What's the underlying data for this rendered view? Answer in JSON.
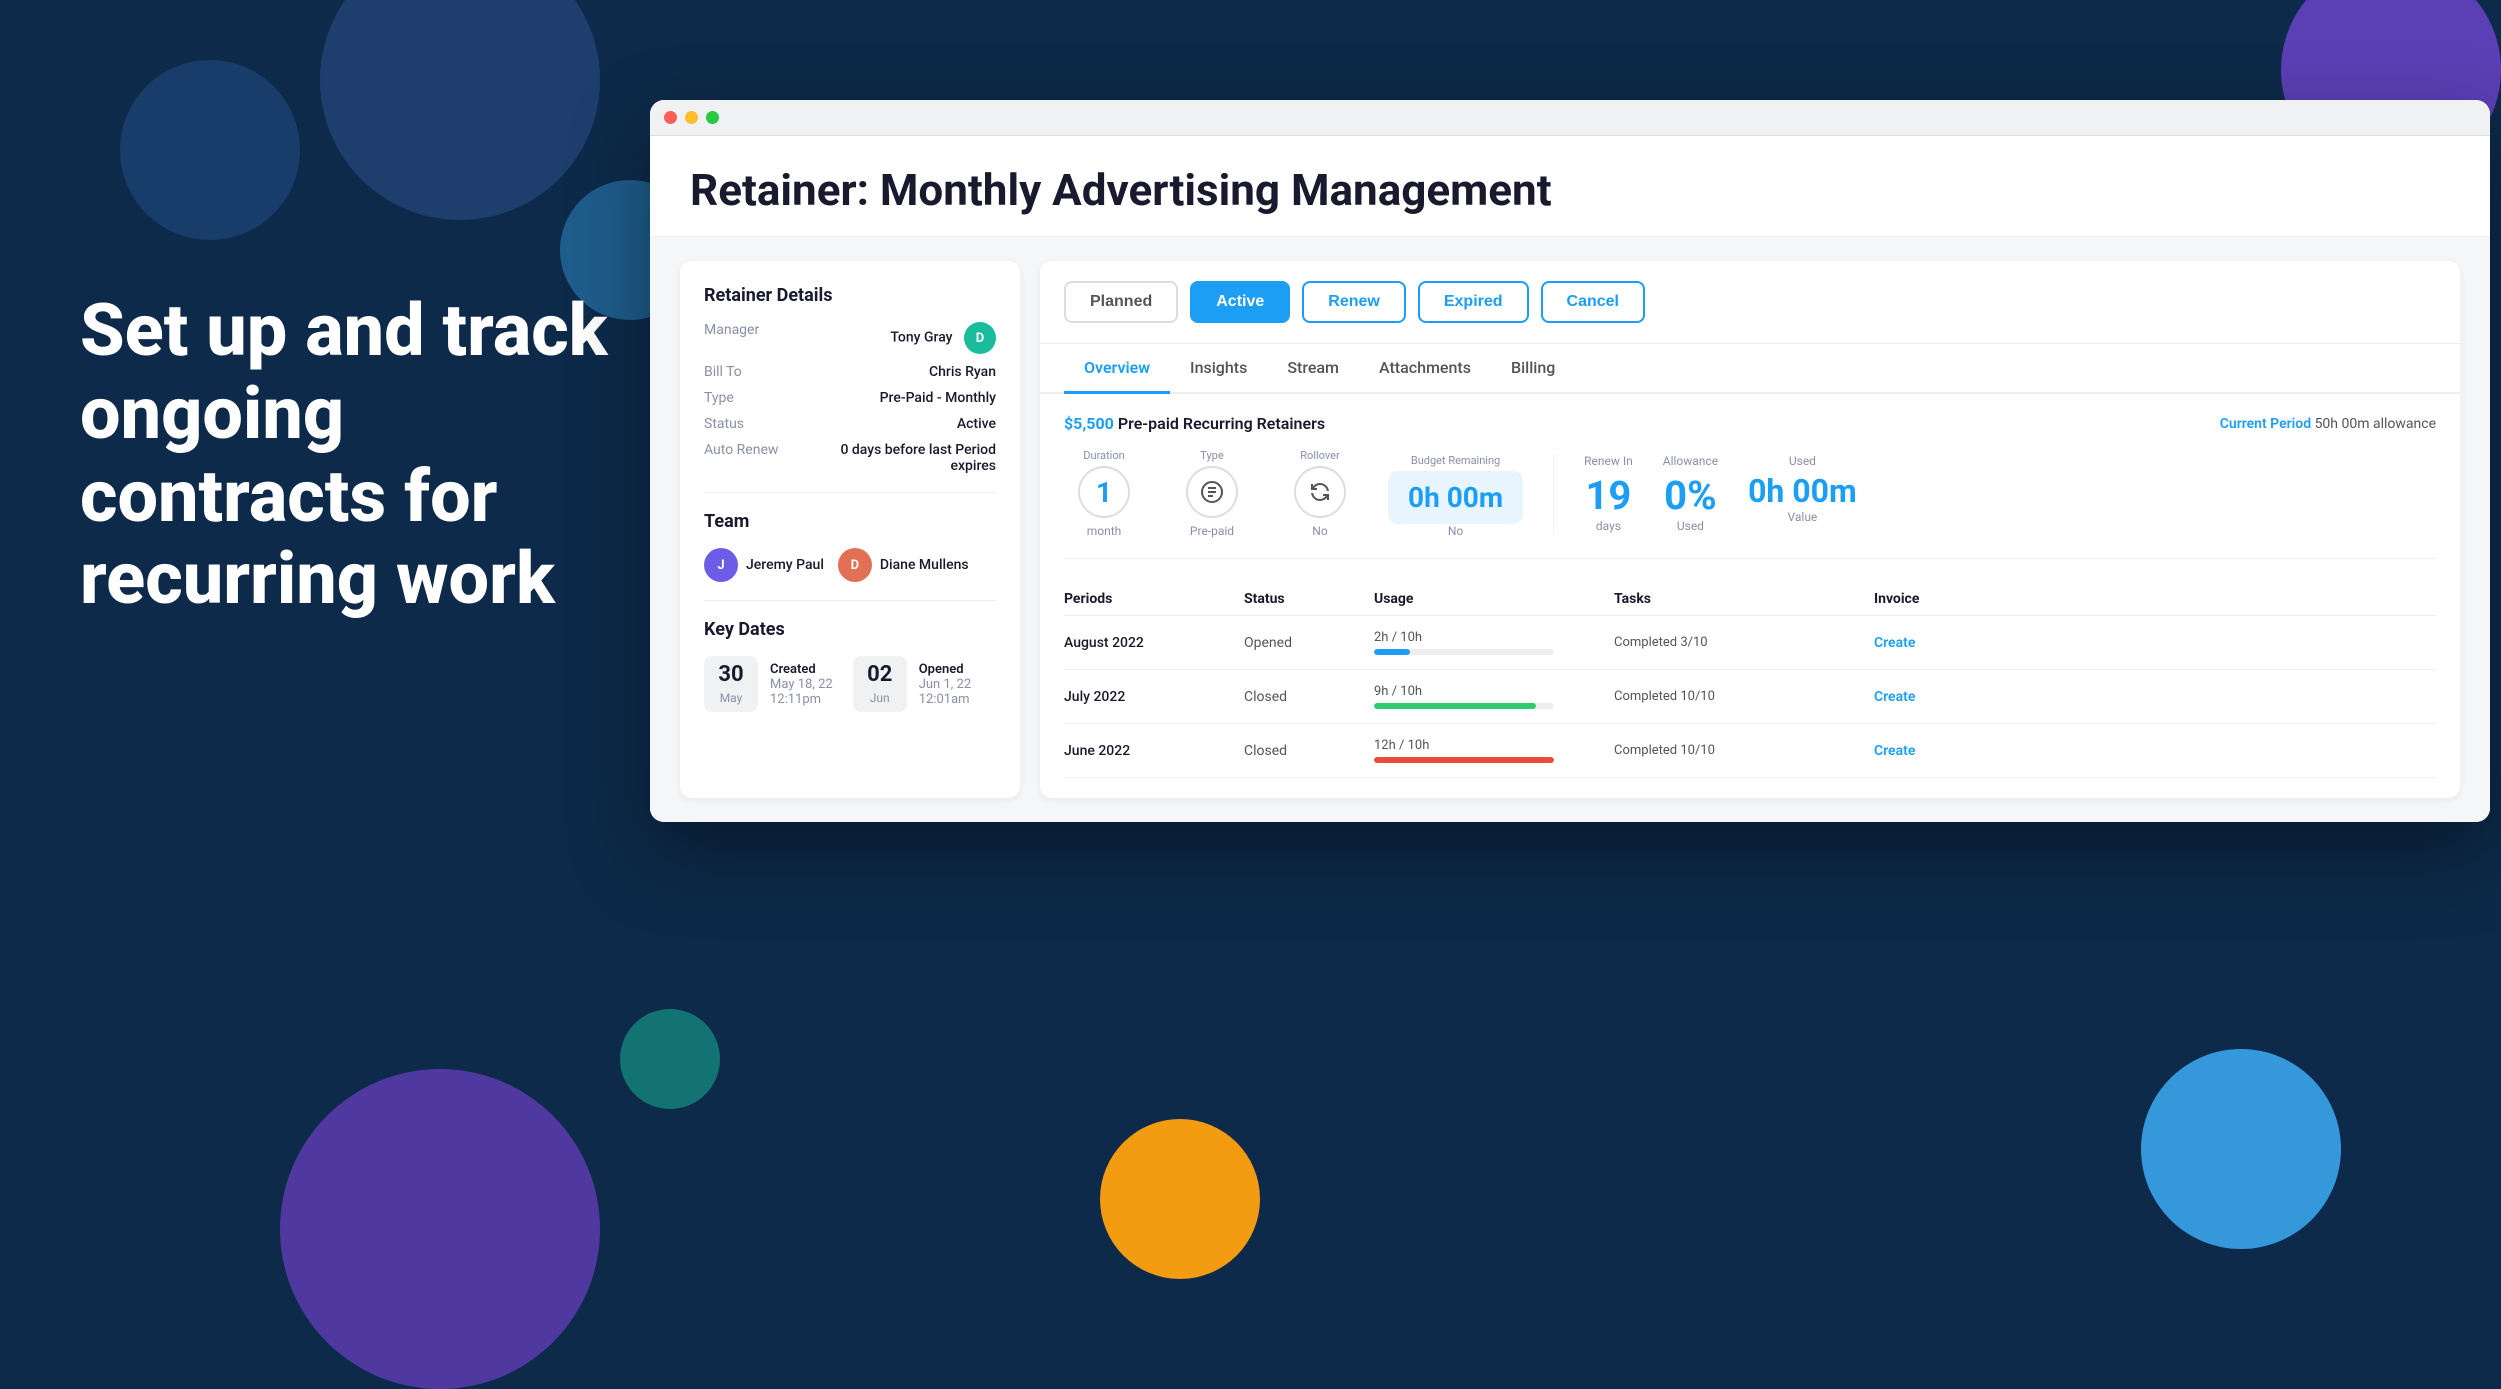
{
  "background": {
    "color": "#0d2a4a"
  },
  "hero": {
    "text": "Set up and track ongoing contracts for recurring work"
  },
  "window": {
    "title": "Retainer: Monthly Advertising Management",
    "dots": [
      "red",
      "yellow",
      "green"
    ]
  },
  "retainer_details": {
    "section_title": "Retainer Details",
    "fields": [
      {
        "label": "Manager",
        "value": "Tony Gray",
        "avatar": "D"
      },
      {
        "label": "Bill To",
        "value": "Chris Ryan"
      },
      {
        "label": "Type",
        "value": "Pre-Paid - Monthly"
      },
      {
        "label": "Status",
        "value": "Active"
      },
      {
        "label": "Auto Renew",
        "value": "0 days before last Period expires"
      }
    ]
  },
  "team": {
    "section_title": "Team",
    "members": [
      {
        "name": "Jeremy Paul",
        "initial": "J",
        "color": "purple"
      },
      {
        "name": "Diane Mullens",
        "initial": "D",
        "color": "orange"
      }
    ]
  },
  "key_dates": {
    "section_title": "Key Dates",
    "dates": [
      {
        "day": "30",
        "month": "May",
        "type": "Created",
        "detail": "May 18, 22\n12:11pm"
      },
      {
        "day": "02",
        "month": "Jun",
        "type": "Opened",
        "detail": "Jun 1, 22\n12:01am"
      }
    ]
  },
  "status_buttons": [
    {
      "label": "Planned",
      "state": "default"
    },
    {
      "label": "Active",
      "state": "active"
    },
    {
      "label": "Renew",
      "state": "outline"
    },
    {
      "label": "Expired",
      "state": "outline"
    },
    {
      "label": "Cancel",
      "state": "outline"
    }
  ],
  "tabs": [
    {
      "label": "Overview",
      "active": true
    },
    {
      "label": "Insights",
      "active": false
    },
    {
      "label": "Stream",
      "active": false
    },
    {
      "label": "Attachments",
      "active": false
    },
    {
      "label": "Billing",
      "active": false
    }
  ],
  "overview": {
    "prepaid_label": "$5,500 Pre-paid Recurring Retainers",
    "current_period_label": "Current Period",
    "current_period_value": "50h 00m allowance",
    "stats_left": {
      "duration": {
        "value": "1",
        "label": "month"
      },
      "type": {
        "value": "Pre-paid",
        "label": "Type"
      },
      "rollover": {
        "value": "No",
        "label": "No"
      },
      "budget": {
        "value": "0h 00m",
        "sub": "No",
        "label": "Budget Remaining"
      }
    },
    "stats_right": {
      "renew_in": {
        "label": "Renew In",
        "value": "19",
        "sub": "days"
      },
      "allowance": {
        "label": "Allowance",
        "value": "0%",
        "sub": "Used"
      },
      "used": {
        "label": "Used",
        "value": "0h 00m",
        "sub": "Value"
      }
    },
    "periods_headers": [
      "Periods",
      "Status",
      "Usage",
      "Tasks",
      "Invoice"
    ],
    "periods": [
      {
        "name": "August 2022",
        "status": "Opened",
        "usage_text": "2h / 10h",
        "progress": 20,
        "progress_color": "blue",
        "tasks": "Completed 3/10",
        "invoice": "Create"
      },
      {
        "name": "July 2022",
        "status": "Closed",
        "usage_text": "9h / 10h",
        "progress": 90,
        "progress_color": "green",
        "tasks": "Completed 10/10",
        "invoice": "Create"
      },
      {
        "name": "June 2022",
        "status": "Closed",
        "usage_text": "12h / 10h",
        "progress": 100,
        "progress_color": "red",
        "tasks": "Completed 10/10",
        "invoice": "Create"
      }
    ]
  }
}
